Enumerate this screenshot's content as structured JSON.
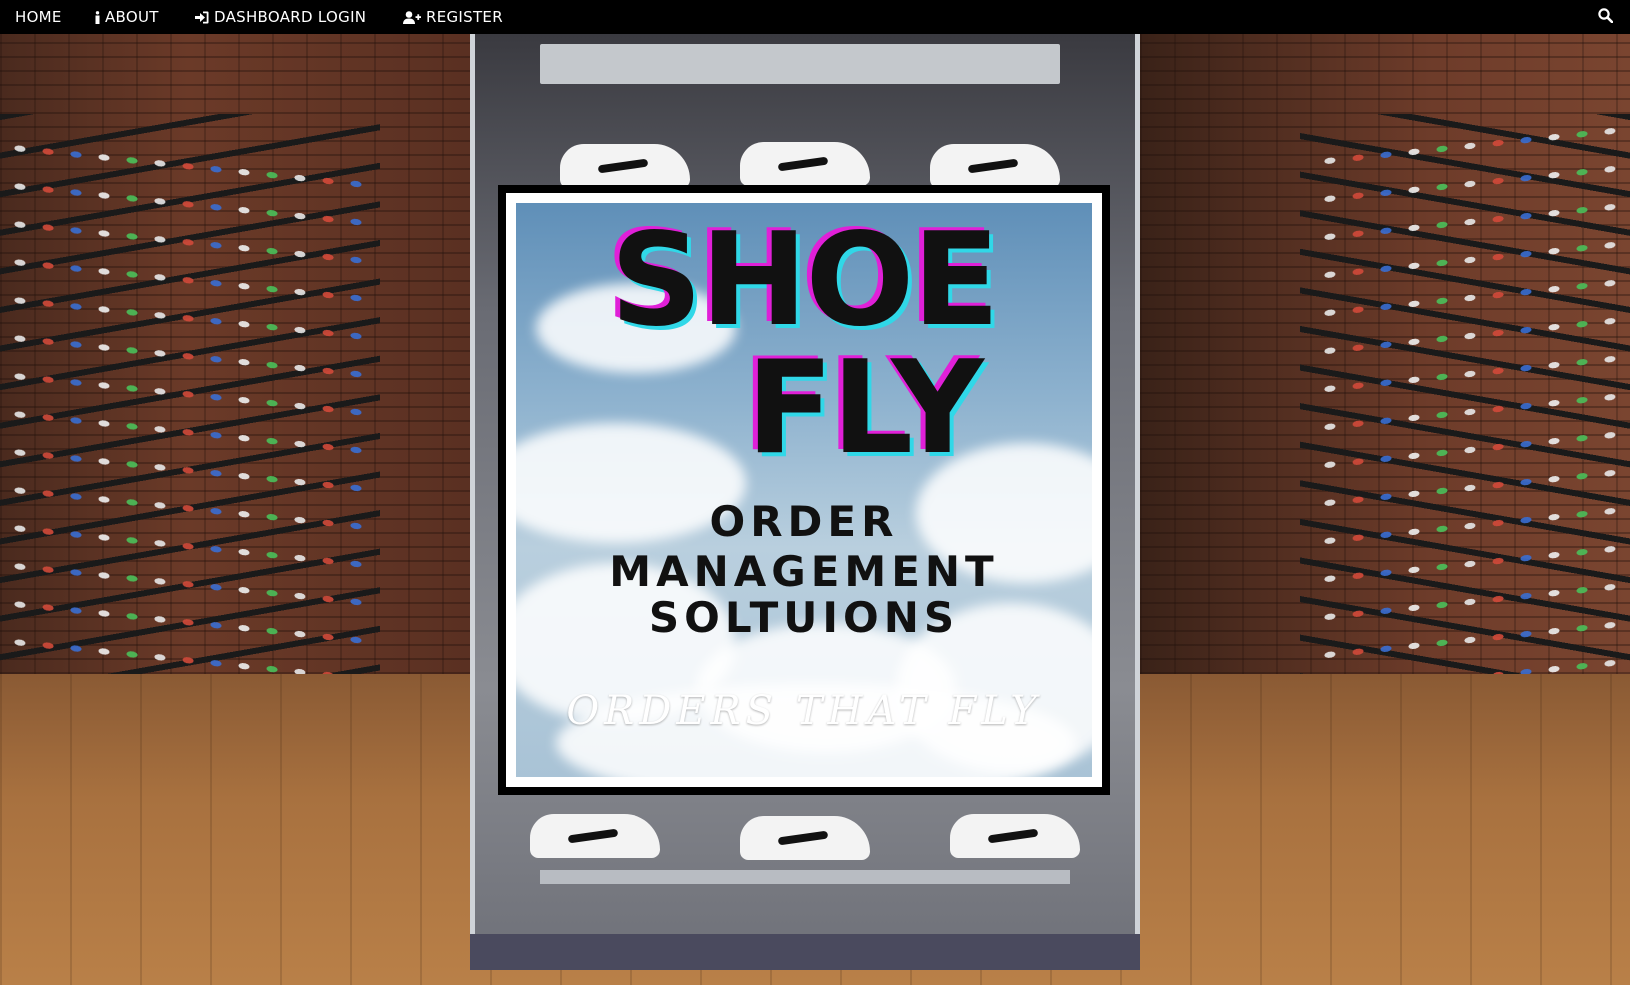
{
  "nav": {
    "home_label": "HOME",
    "about_label": "ABOUT",
    "about_icon": "info-icon",
    "login_label": "DASHBOARD LOGIN",
    "login_icon": "sign-in-icon",
    "register_label": "REGISTER",
    "register_icon": "user-plus-icon",
    "search_icon": "search-icon"
  },
  "poster": {
    "title_line1": "SHOE",
    "title_line2": "FLY",
    "subtitle_line1": "ORDER",
    "subtitle_line2": "MANAGEMENT",
    "subtitle_line3": "SOLTUIONS",
    "tagline": "ORDERS THAT FLY"
  },
  "colors": {
    "nav_bg": "#000000",
    "nav_text": "#ffffff",
    "title_shadow_pink": "#e020d8",
    "title_shadow_cyan": "#30d8e8"
  }
}
